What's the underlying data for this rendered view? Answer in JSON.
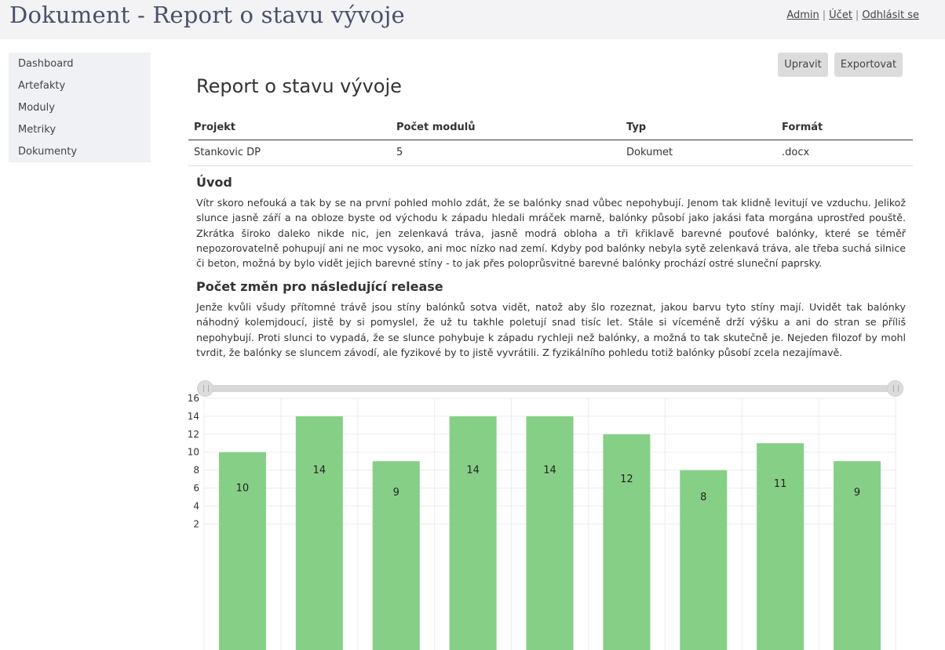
{
  "app": {
    "title": "Dokument - Report o stavu vývoje",
    "nav_admin": "Admin",
    "nav_account": "Účet",
    "nav_logout": "Odhlásit se",
    "separator": "|"
  },
  "sidebar": {
    "items": [
      {
        "label": "Dashboard"
      },
      {
        "label": "Artefakty"
      },
      {
        "label": "Moduly"
      },
      {
        "label": "Metriky"
      },
      {
        "label": "Dokumenty"
      }
    ]
  },
  "toolbar": {
    "edit_label": "Upravit",
    "export_label": "Exportovat"
  },
  "document": {
    "heading": "Report o stavu vývoje",
    "table": {
      "headers": [
        "Projekt",
        "Počet modulů",
        "Typ",
        "Formát"
      ],
      "row": [
        "Stankovic DP",
        "5",
        "Dokumet",
        ".docx"
      ]
    },
    "section1": {
      "title": "Úvod",
      "text": "Vítr skoro nefouká a tak by se na první pohled mohlo zdát, že se balónky snad vůbec nepohybují. Jenom tak klidně levitují ve vzduchu. Jelikož slunce jasně září a na obloze byste od východu k západu hledali mráček marně, balónky působí jako jakási fata morgána uprostřed pouště. Zkrátka široko daleko nikde nic, jen zelenkavá tráva, jasně modrá obloha a tři křiklavě barevné pouťové balónky, které se téměř nepozorovatelně pohupují ani ne moc vysoko, ani moc nízko nad zemí. Kdyby pod balónky nebyla sytě zelenkavá tráva, ale třeba suchá silnice či beton, možná by bylo vidět jejich barevné stíny - to jak přes poloprůsvitné barevné balónky prochází ostré sluneční paprsky."
    },
    "section2": {
      "title": "Počet změn pro následující release",
      "text": "Jenže kvůli všudy přítomné trávě jsou stíny balónků sotva vidět, natož aby šlo rozeznat, jakou barvu tyto stíny mají. Uvidět tak balónky náhodný kolemjdoucí, jistě by si pomyslel, že už tu takhle poletují snad tisíc let. Stále si víceméně drží výšku a ani do stran se příliš nepohybují. Proti slunci to vypadá, že se slunce pohybuje k západu rychleji než balónky, a možná to tak skutečně je. Nejeden filozof by mohl tvrdit, že balónky se sluncem závodí, ale fyzikové by to jistě vyvrátili. Z fyzikálního pohledu totiž balónky působí zcela nezajímavě."
    }
  },
  "range_slider": {
    "start": 0,
    "end": 1
  },
  "chart_data": {
    "type": "bar",
    "values": [
      10,
      14,
      9,
      14,
      14,
      12,
      8,
      11,
      9
    ],
    "data_labels": [
      "10",
      "14",
      "9",
      "14",
      "14",
      "12",
      "8",
      "11",
      "9"
    ],
    "y_ticks": [
      2,
      4,
      6,
      8,
      10,
      12,
      14,
      16
    ],
    "ylim": [
      2,
      16
    ],
    "bar_color": "#86cf86",
    "grid": true,
    "legend": "none"
  }
}
